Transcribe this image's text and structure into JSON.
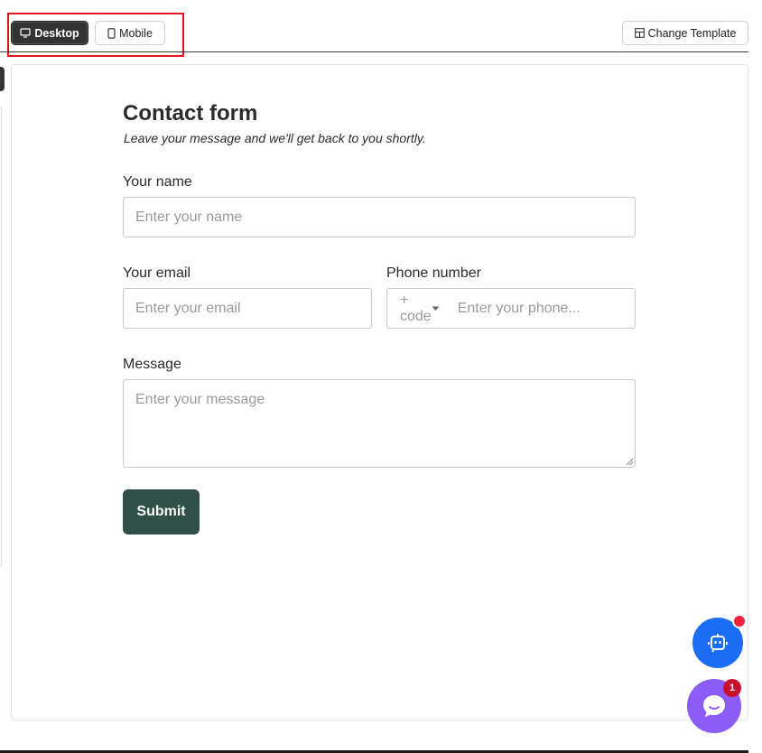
{
  "toolbar": {
    "desktop_label": "Desktop",
    "mobile_label": "Mobile",
    "change_template_label": "Change Template",
    "desktop_icon": "monitor-icon",
    "mobile_icon": "smartphone-icon",
    "template_icon": "layout-template-icon"
  },
  "form": {
    "title": "Contact form",
    "subtitle": "Leave your message and we'll get back to you shortly.",
    "name_label": "Your name",
    "name_placeholder": "Enter your name",
    "email_label": "Your email",
    "email_placeholder": "Enter your email",
    "phone_label": "Phone number",
    "phone_code_placeholder": "+ code",
    "phone_placeholder": "Enter your phone...",
    "message_label": "Message",
    "message_placeholder": "Enter your message",
    "submit_label": "Submit"
  },
  "widgets": {
    "chat_badge_count": "1",
    "bot_icon": "robot-icon",
    "chat_icon": "chat-bubble-icon"
  },
  "colors": {
    "submit_bg": "#2f4f47",
    "bot_bg": "#1d6cf5",
    "chat_bg": "#8c5cf6",
    "highlight": "#e0141e"
  }
}
